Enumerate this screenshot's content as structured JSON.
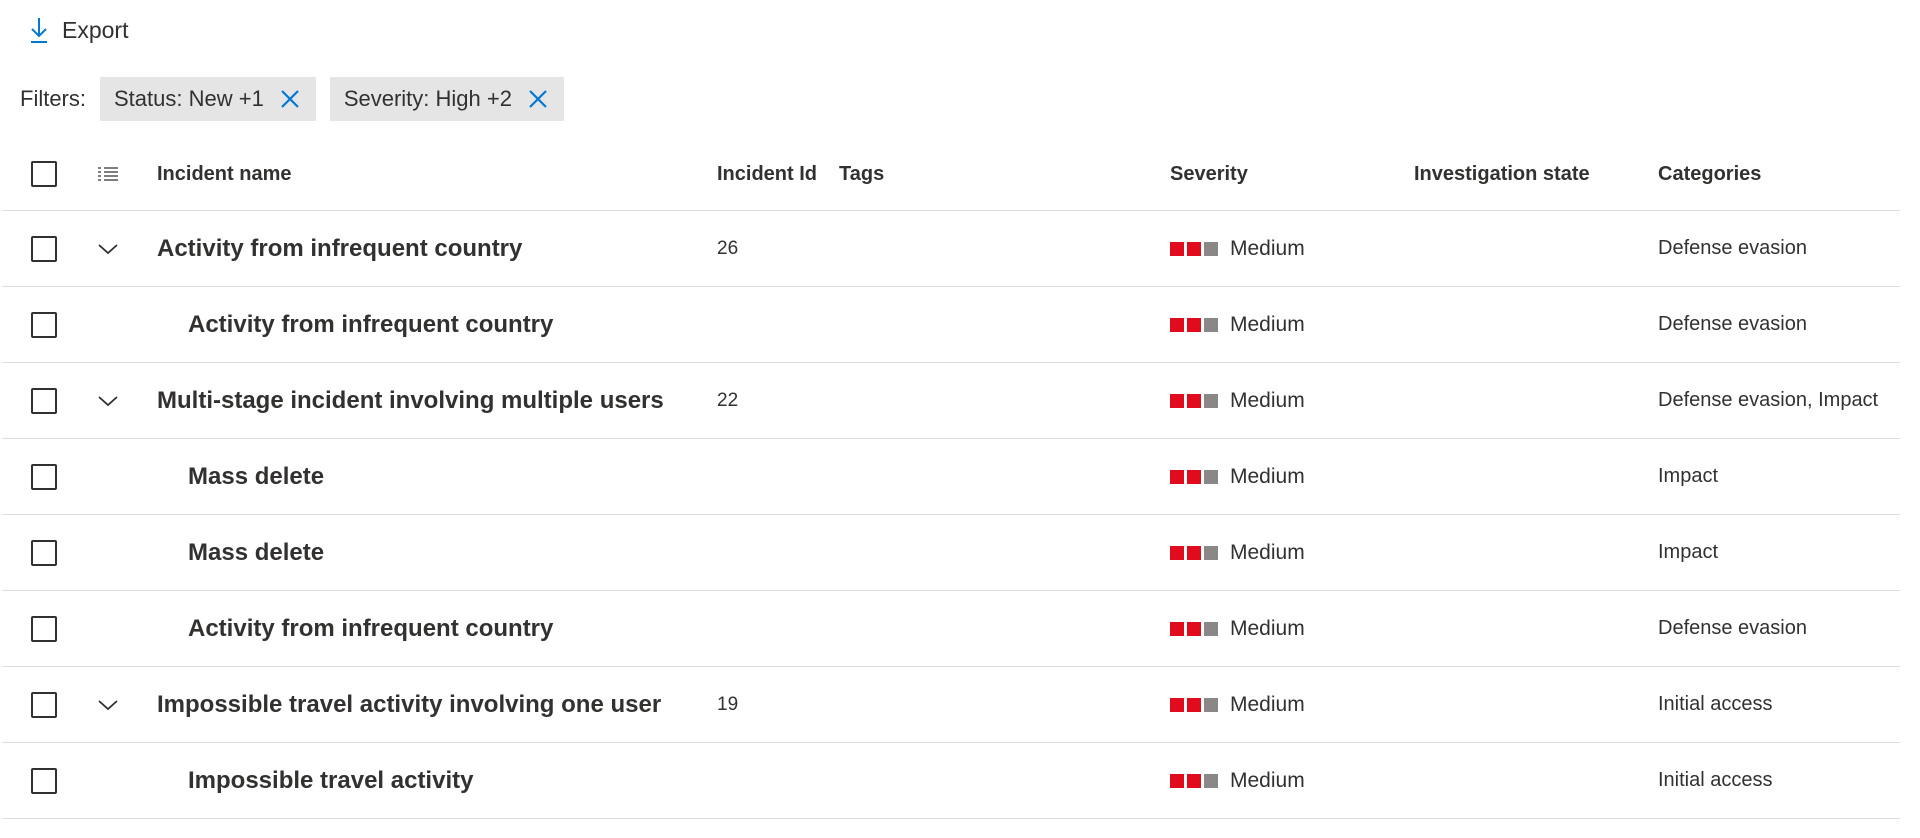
{
  "toolbar": {
    "export_label": "Export"
  },
  "filters": {
    "label": "Filters:",
    "pills": [
      {
        "text": "Status: New +1"
      },
      {
        "text": "Severity: High +2"
      }
    ]
  },
  "table": {
    "columns": {
      "incident_name": "Incident name",
      "incident_id": "Incident Id",
      "tags": "Tags",
      "severity": "Severity",
      "investigation_state": "Investigation state",
      "categories": "Categories"
    },
    "rows": [
      {
        "name": "Activity from infrequent country",
        "id": "26",
        "severity": "Medium",
        "categories": "Defense evasion",
        "parent": true
      },
      {
        "name": "Activity from infrequent country",
        "id": "",
        "severity": "Medium",
        "categories": "Defense evasion",
        "parent": false
      },
      {
        "name": "Multi-stage incident involving multiple users",
        "id": "22",
        "severity": "Medium",
        "categories": "Defense evasion, Impact",
        "parent": true
      },
      {
        "name": "Mass delete",
        "id": "",
        "severity": "Medium",
        "categories": "Impact",
        "parent": false
      },
      {
        "name": "Mass delete",
        "id": "",
        "severity": "Medium",
        "categories": "Impact",
        "parent": false
      },
      {
        "name": "Activity from infrequent country",
        "id": "",
        "severity": "Medium",
        "categories": "Defense evasion",
        "parent": false
      },
      {
        "name": "Impossible travel activity involving one user",
        "id": "19",
        "severity": "Medium",
        "categories": "Initial access",
        "parent": true
      },
      {
        "name": "Impossible travel activity",
        "id": "",
        "severity": "Medium",
        "categories": "Initial access",
        "parent": false
      }
    ]
  },
  "icons": {
    "export": "download-arrow-icon",
    "remove_filter": "close-icon",
    "column_options": "list-icon",
    "expand": "chevron-down-icon"
  },
  "colors": {
    "accent": "#0078d4",
    "severity_active": "#e00b1c",
    "severity_inactive": "#8a8886",
    "row_border": "#e1dfdd",
    "pill_bg": "#e5e5e5"
  }
}
